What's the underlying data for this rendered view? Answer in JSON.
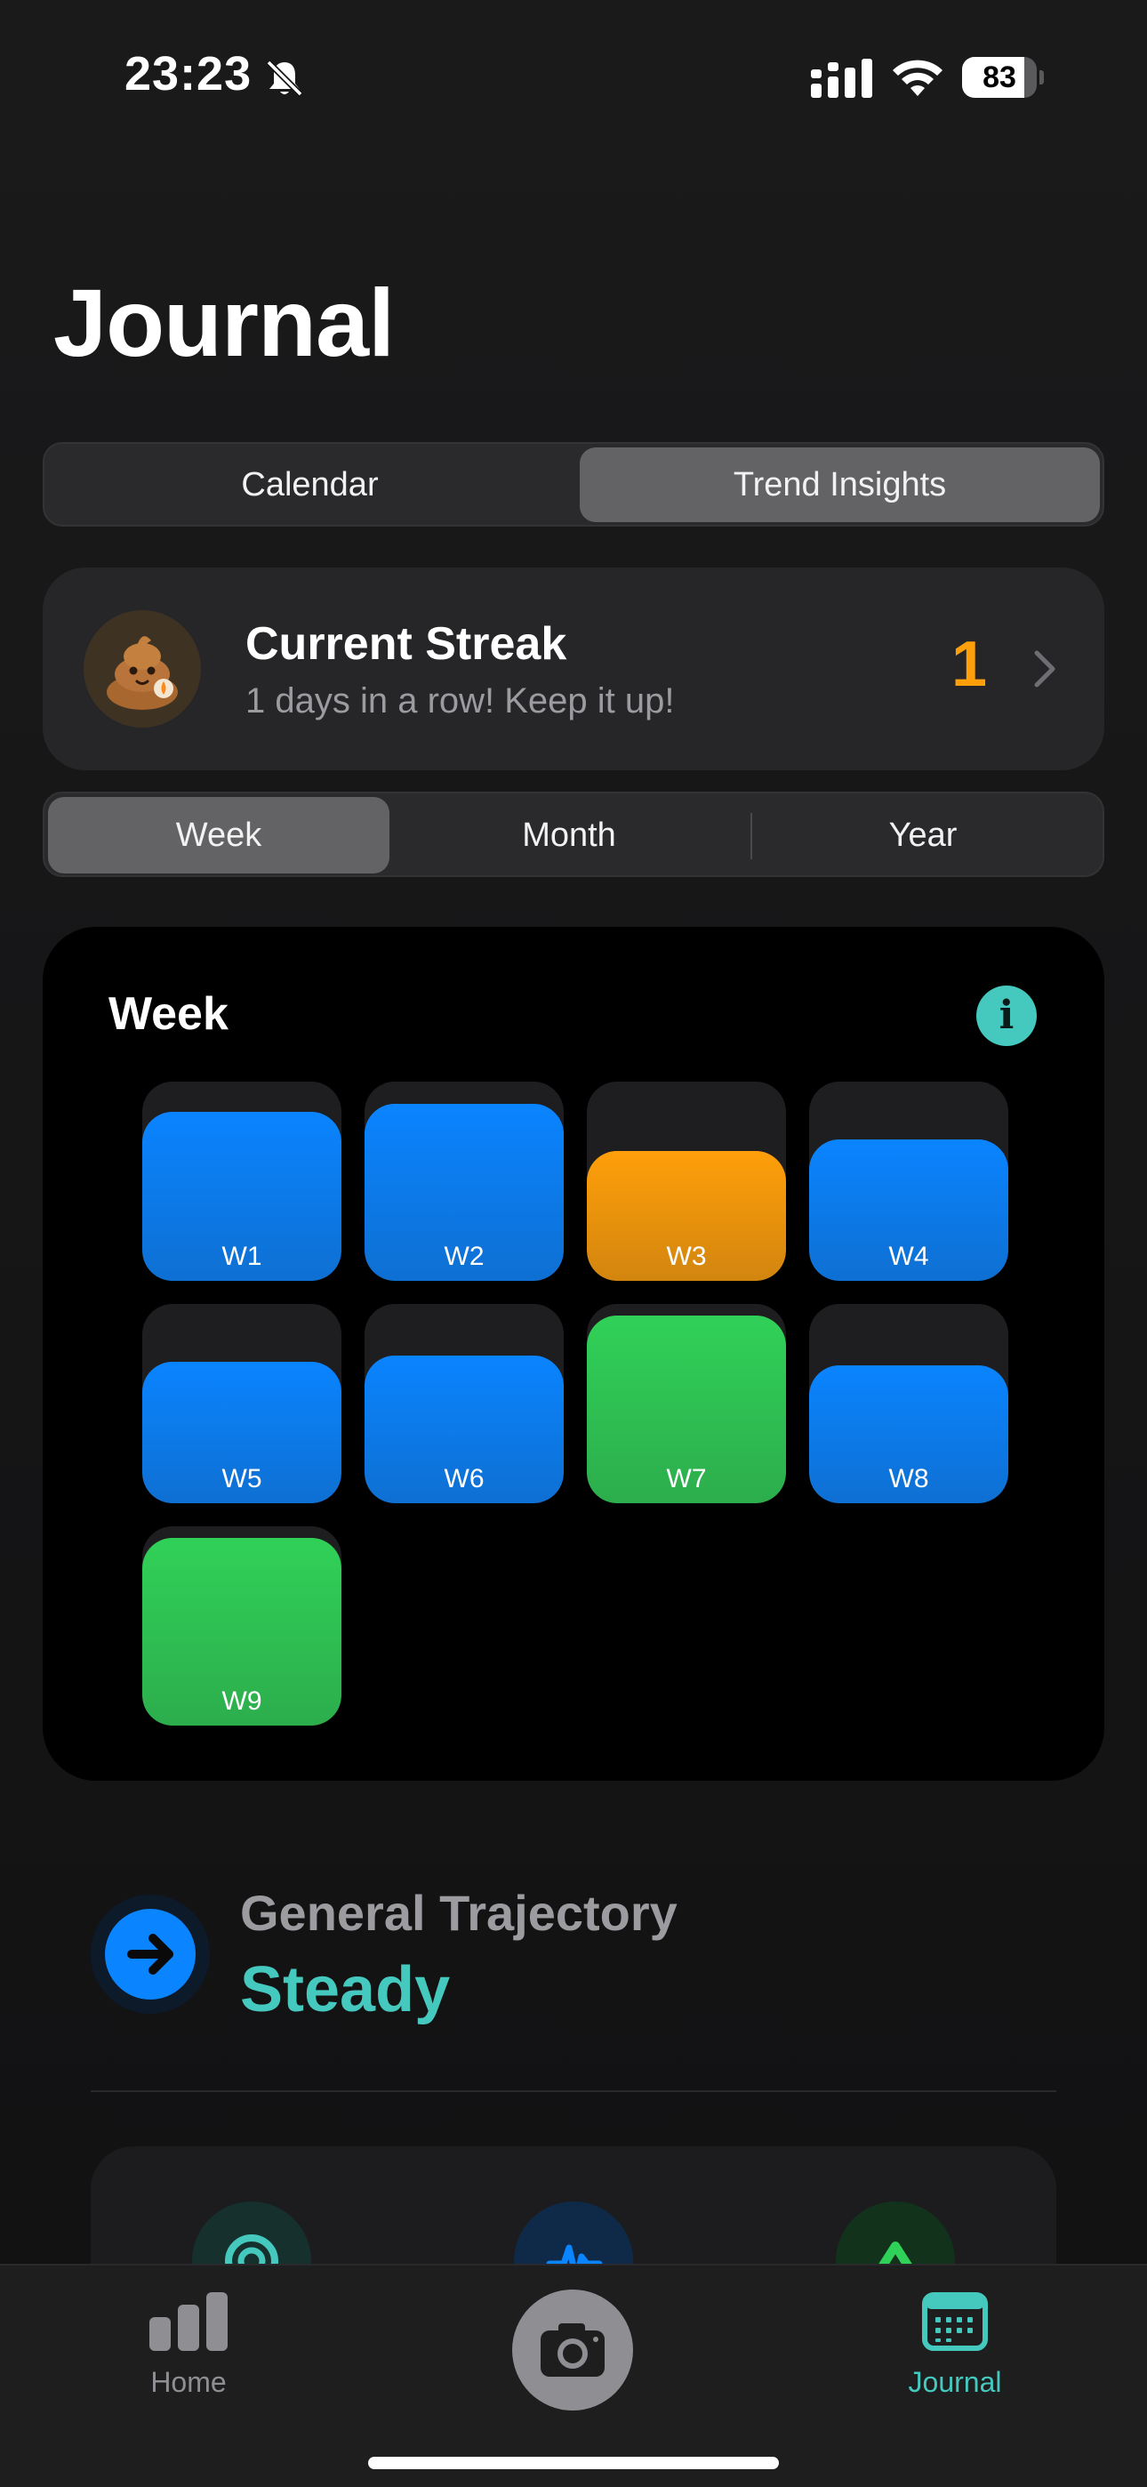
{
  "status_bar": {
    "time": "23:23",
    "battery_level": "83",
    "icons": [
      "bell-slash-icon",
      "cellular-signal-icon",
      "wifi-icon",
      "battery-icon"
    ]
  },
  "page": {
    "title": "Journal"
  },
  "view_switch": {
    "options": [
      "Calendar",
      "Trend Insights"
    ],
    "selected": "Trend Insights"
  },
  "streak": {
    "title": "Current Streak",
    "subtitle": "1 days in a row! Keep it up!",
    "count": "1",
    "accent": "#ff9f0a"
  },
  "range_switch": {
    "options": [
      "Week",
      "Month",
      "Year"
    ],
    "selected": "Week"
  },
  "week_chart": {
    "title": "Week",
    "info_glyph": "i",
    "colors": {
      "blue": "#0a84ff",
      "orange": "#ff9f0a",
      "green": "#30d158",
      "empty": "#1e1e20"
    },
    "weeks": [
      {
        "label": "W1",
        "level": 0.85,
        "color": "blue"
      },
      {
        "label": "W2",
        "level": 0.89,
        "color": "blue"
      },
      {
        "label": "W3",
        "level": 0.65,
        "color": "orange"
      },
      {
        "label": "W4",
        "level": 0.71,
        "color": "blue"
      },
      {
        "label": "W5",
        "level": 0.71,
        "color": "blue"
      },
      {
        "label": "W6",
        "level": 0.74,
        "color": "blue"
      },
      {
        "label": "W7",
        "level": 0.94,
        "color": "green"
      },
      {
        "label": "W8",
        "level": 0.69,
        "color": "blue"
      },
      {
        "label": "W9",
        "level": 0.94,
        "color": "green"
      }
    ]
  },
  "trajectory": {
    "label": "General Trajectory",
    "value": "Steady",
    "accent": "#45c9be",
    "icon": "arrow-right-icon"
  },
  "tab_bar": {
    "home": {
      "label": "Home",
      "icon": "bar-chart-icon"
    },
    "camera": {
      "icon": "camera-icon"
    },
    "journal": {
      "label": "Journal",
      "icon": "calendar-icon",
      "active": true
    }
  }
}
